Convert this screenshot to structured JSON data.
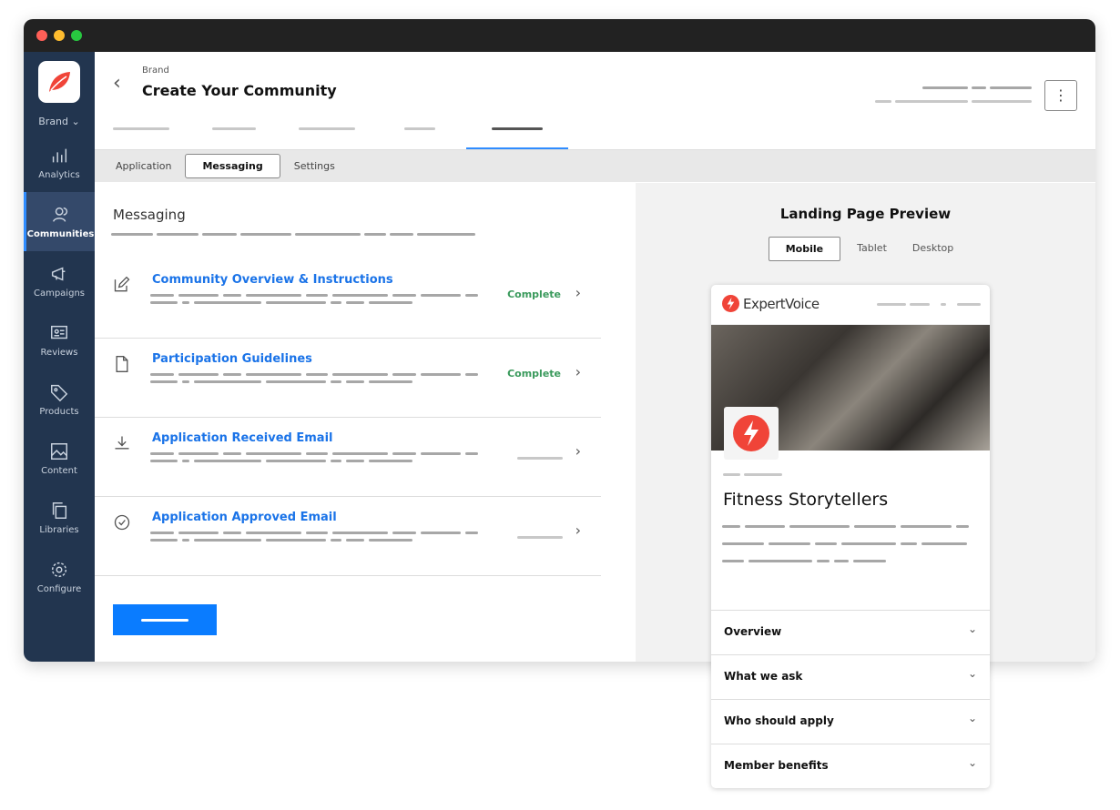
{
  "sidebar": {
    "brand": "Brand",
    "items": [
      {
        "label": "Analytics",
        "icon": "bar-chart-icon"
      },
      {
        "label": "Communities",
        "icon": "people-icon",
        "active": true
      },
      {
        "label": "Campaigns",
        "icon": "megaphone-icon"
      },
      {
        "label": "Reviews",
        "icon": "review-icon"
      },
      {
        "label": "Products",
        "icon": "tag-icon"
      },
      {
        "label": "Content",
        "icon": "image-icon"
      },
      {
        "label": "Libraries",
        "icon": "copy-icon"
      },
      {
        "label": "Configure",
        "icon": "gear-icon"
      }
    ]
  },
  "header": {
    "breadcrumb": "Brand",
    "title": "Create Your Community",
    "more": "⋮"
  },
  "subtabs": [
    "Application",
    "Messaging",
    "Settings"
  ],
  "messaging": {
    "heading": "Messaging",
    "items": [
      {
        "title": "Community Overview & Instructions",
        "status": "Complete",
        "icon": "edit-icon"
      },
      {
        "title": "Participation Guidelines",
        "status": "Complete",
        "icon": "document-icon"
      },
      {
        "title": "Application Received Email",
        "status": "",
        "icon": "download-icon"
      },
      {
        "title": "Application Approved Email",
        "status": "",
        "icon": "check-circle-icon"
      }
    ]
  },
  "preview": {
    "heading": "Landing Page Preview",
    "devices": [
      "Mobile",
      "Tablet",
      "Desktop"
    ],
    "selected_device": "Mobile",
    "logo_text": "ExpertVoice",
    "community_title": "Fitness Storytellers",
    "sections": [
      "Overview",
      "What we ask",
      "Who should apply",
      "Member benefits"
    ]
  },
  "colors": {
    "accent": "#0a7cff",
    "sidebar": "#22354f",
    "complete": "#3a9a5c",
    "brand_red": "#f04438"
  }
}
